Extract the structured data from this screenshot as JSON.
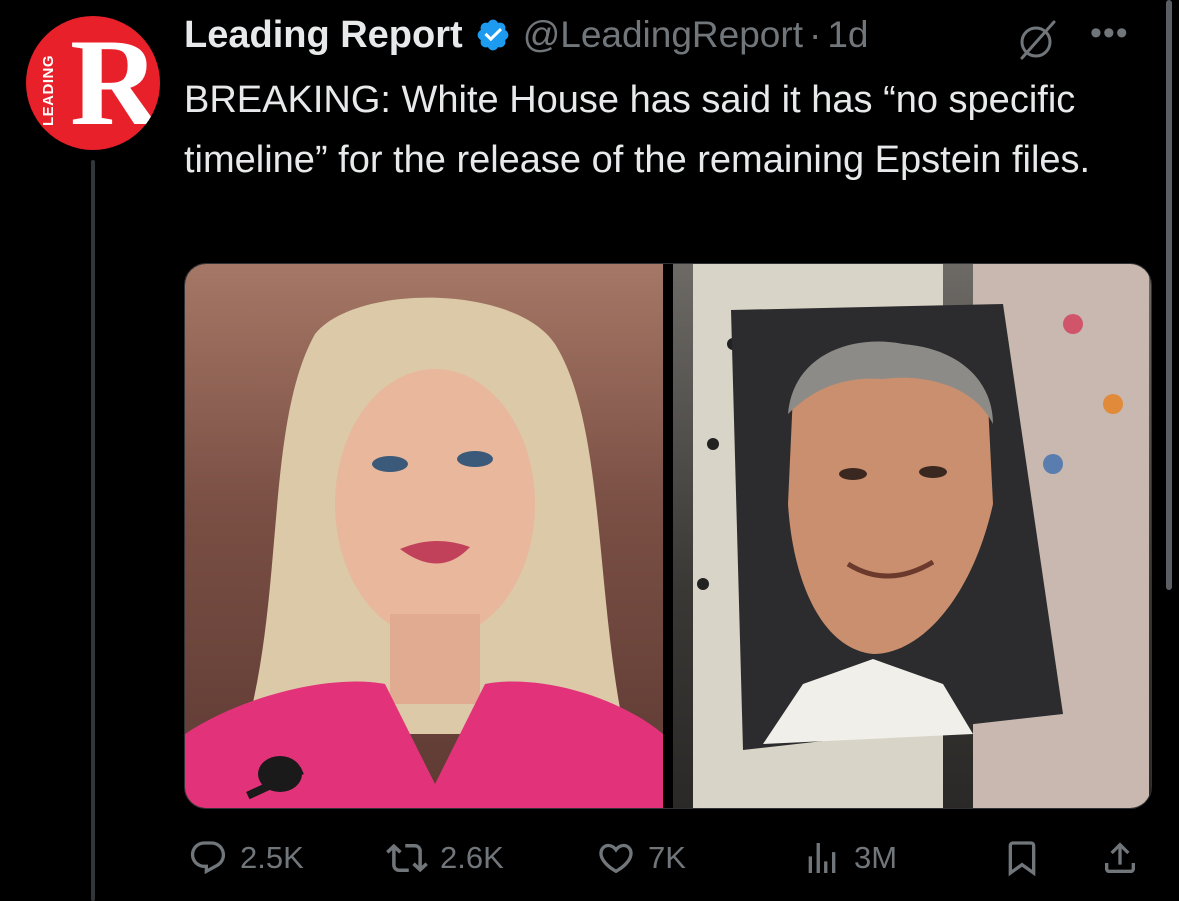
{
  "author": {
    "display_name": "Leading Report",
    "handle": "@LeadingReport",
    "separator": "·",
    "time": "1d",
    "verified": true,
    "avatar": {
      "letter": "R",
      "side_text": "LEADING",
      "color": "#e8202a"
    }
  },
  "tweet": {
    "text": "BREAKING: White House has said it has “no specific timeline” for the release of the remaining Epstein files."
  },
  "media": [
    {
      "name": "photo-woman-pink-jacket"
    },
    {
      "name": "photo-portrait-poster"
    }
  ],
  "metrics": {
    "replies": "2.5K",
    "reposts": "2.6K",
    "likes": "7K",
    "views": "3M"
  },
  "icons": {
    "reply": "reply-icon",
    "repost": "repost-icon",
    "like": "heart-icon",
    "views": "views-icon",
    "bookmark": "bookmark-icon",
    "share": "share-icon",
    "grok": "grok-icon",
    "more": "more-icon",
    "verified": "verified-badge-icon"
  },
  "colors": {
    "background": "#000000",
    "text_primary": "#e7e9ea",
    "text_secondary": "#71767b",
    "verified_blue": "#1d9bf0",
    "brand_red": "#e8202a"
  }
}
